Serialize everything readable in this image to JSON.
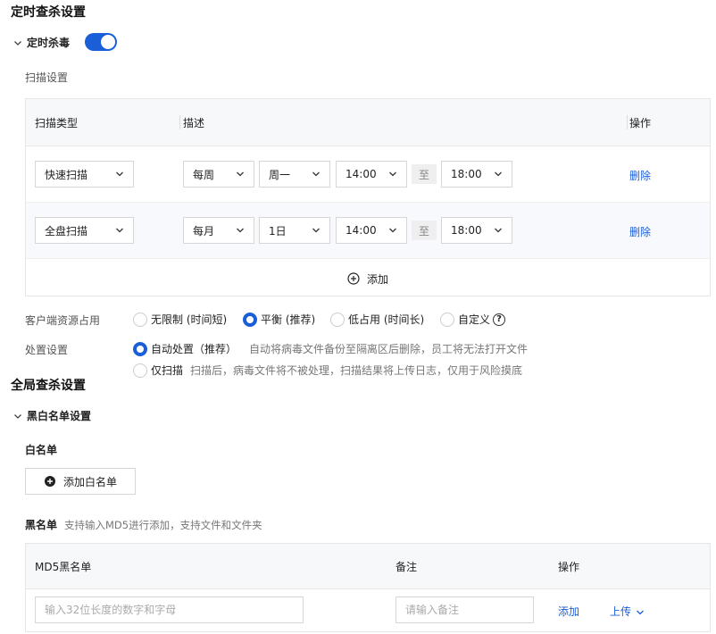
{
  "scheduled": {
    "section_title": "定时查杀设置",
    "toggle_label": "定时杀毒",
    "toggle_on": true,
    "scan_settings_label": "扫描设置",
    "table": {
      "headers": [
        "扫描类型",
        "描述",
        "操作"
      ],
      "rows": [
        {
          "type": "快速扫描",
          "freq": "每周",
          "day": "周一",
          "start": "14:00",
          "to": "至",
          "end": "18:00",
          "action": "删除"
        },
        {
          "type": "全盘扫描",
          "freq": "每月",
          "day": "1日",
          "start": "14:00",
          "to": "至",
          "end": "18:00",
          "action": "删除"
        }
      ],
      "add_label": "添加"
    },
    "resource": {
      "label": "客户端资源占用",
      "options": [
        "无限制 (时间短)",
        "平衡 (推荐)",
        "低占用 (时间长)",
        "自定义"
      ],
      "selected_index": 1,
      "help_icon": "?"
    },
    "handling": {
      "label": "处置设置",
      "options": [
        {
          "title": "自动处置（推荐）",
          "desc": "自动将病毒文件备份至隔离区后删除，员工将无法打开文件"
        },
        {
          "title": "仅扫描",
          "desc": "扫描后，病毒文件将不被处理，扫描结果将上传日志，仅用于风险摸底"
        }
      ],
      "selected_index": 0
    }
  },
  "global": {
    "section_title": "全局查杀设置",
    "bw_label": "黑白名单设置",
    "whitelist": {
      "title": "白名单",
      "add_button": "添加白名单"
    },
    "blacklist": {
      "title": "黑名单",
      "hint": "支持输入MD5进行添加，支持文件和文件夹",
      "headers": [
        "MD5黑名单",
        "备注",
        "操作"
      ],
      "md5_placeholder": "输入32位长度的数字和字母",
      "note_placeholder": "请输入备注",
      "add_action": "添加",
      "upload_action": "上传"
    }
  },
  "colors": {
    "accent": "#1a5fd8",
    "header_bg": "#f7f8fa",
    "border": "#e6e6e6"
  }
}
